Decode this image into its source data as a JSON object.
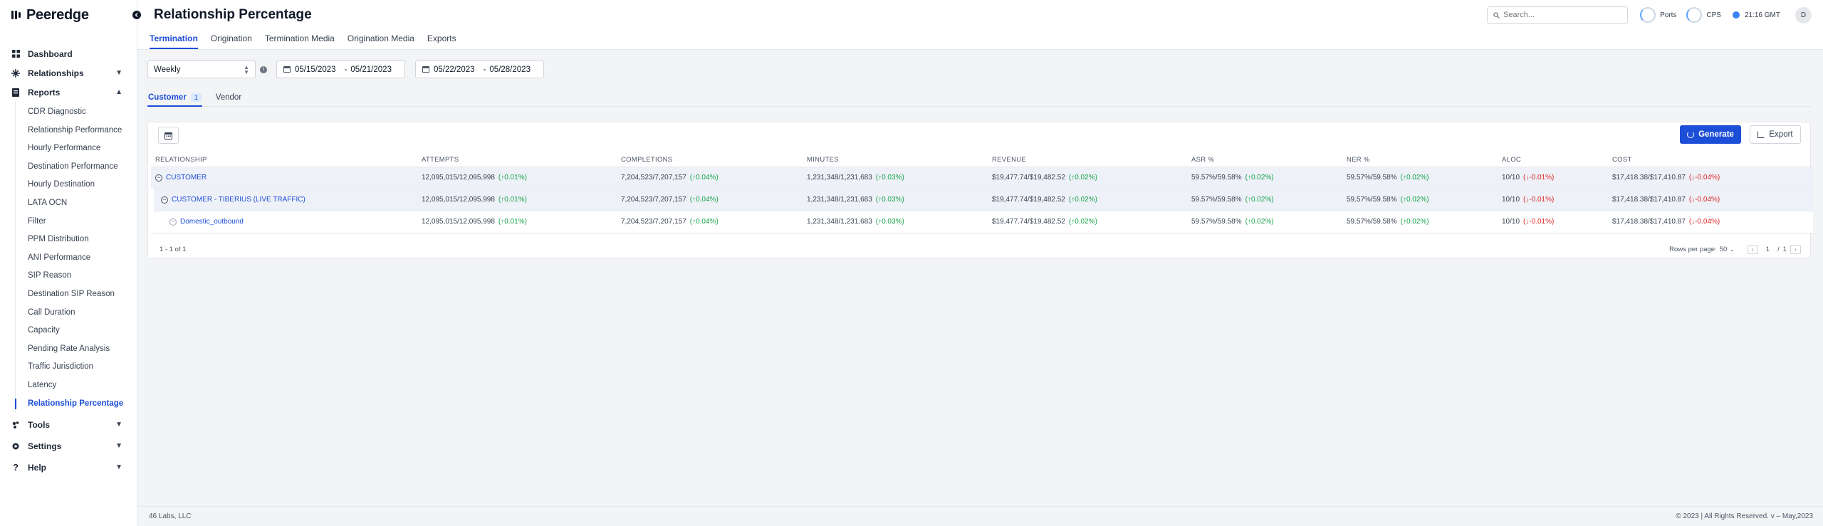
{
  "app": {
    "name": "Peeredge"
  },
  "header": {
    "title": "Relationship Percentage",
    "search_placeholder": "Search...",
    "ports_label": "Ports",
    "cps_label": "CPS",
    "time": "21:16 GMT",
    "avatar_initial": "D"
  },
  "sidebar": {
    "dashboard": "Dashboard",
    "relationships": "Relationships",
    "reports": "Reports",
    "report_items": [
      "CDR Diagnostic",
      "Relationship Performance",
      "Hourly Performance",
      "Destination Performance",
      "Hourly Destination",
      "LATA OCN",
      "Filter",
      "PPM Distribution",
      "ANI Performance",
      "SIP Reason",
      "Destination SIP Reason",
      "Call Duration",
      "Capacity",
      "Pending Rate Analysis",
      "Traffic Jurisdiction",
      "Latency",
      "Relationship Percentage"
    ],
    "tools": "Tools",
    "settings": "Settings",
    "help": "Help"
  },
  "tabs": [
    "Termination",
    "Origination",
    "Termination Media",
    "Origination Media",
    "Exports"
  ],
  "filters": {
    "period": "Weekly",
    "range1_start": "05/15/2023",
    "range1_end": "05/21/2023",
    "range2_start": "05/22/2023",
    "range2_end": "05/28/2023"
  },
  "subtabs": {
    "customer": "Customer",
    "customer_count": "1",
    "vendor": "Vendor"
  },
  "actions": {
    "generate": "Generate",
    "export": "Export"
  },
  "table": {
    "headers": [
      "RELATIONSHIP",
      "ATTEMPTS",
      "COMPLETIONS",
      "MINUTES",
      "REVENUE",
      "ASR %",
      "NER %",
      "ALOC",
      "COST"
    ],
    "rows": [
      {
        "name": "CUSTOMER",
        "toggle": "−",
        "attempts": "12,095,015/12,095,998",
        "attempts_delta": "(↑0.01%)",
        "completions": "7,204,523/7,207,157",
        "completions_delta": "(↑0.04%)",
        "minutes": "1,231,348/1,231,683",
        "minutes_delta": "(↑0.03%)",
        "revenue": "$19,477.74/$19,482.52",
        "revenue_delta": "(↑0.02%)",
        "asr": "59.57%/59.58%",
        "asr_delta": "(↑0.02%)",
        "ner": "59.57%/59.58%",
        "ner_delta": "(↑0.02%)",
        "aloc": "10/10",
        "aloc_delta": "(↓-0.01%)",
        "cost": "$17,418.38/$17,410.87",
        "cost_delta": "(↓-0.04%)"
      },
      {
        "name": "CUSTOMER - TIBERIUS (LIVE TRAFFIC)",
        "toggle": "−",
        "attempts": "12,095,015/12,095,998",
        "attempts_delta": "(↑0.01%)",
        "completions": "7,204,523/7,207,157",
        "completions_delta": "(↑0.04%)",
        "minutes": "1,231,348/1,231,683",
        "minutes_delta": "(↑0.03%)",
        "revenue": "$19,477.74/$19,482.52",
        "revenue_delta": "(↑0.02%)",
        "asr": "59.57%/59.58%",
        "asr_delta": "(↑0.02%)",
        "ner": "59.57%/59.58%",
        "ner_delta": "(↑0.02%)",
        "aloc": "10/10",
        "aloc_delta": "(↓-0.01%)",
        "cost": "$17,418.38/$17,410.87",
        "cost_delta": "(↓-0.04%)"
      },
      {
        "name": "Domestic_outbound",
        "toggle": "−",
        "attempts": "12,095,015/12,095,998",
        "attempts_delta": "(↑0.01%)",
        "completions": "7,204,523/7,207,157",
        "completions_delta": "(↑0.04%)",
        "minutes": "1,231,348/1,231,683",
        "minutes_delta": "(↑0.03%)",
        "revenue": "$19,477.74/$19,482.52",
        "revenue_delta": "(↑0.02%)",
        "asr": "59.57%/59.58%",
        "asr_delta": "(↑0.02%)",
        "ner": "59.57%/59.58%",
        "ner_delta": "(↑0.02%)",
        "aloc": "10/10",
        "aloc_delta": "(↓-0.01%)",
        "cost": "$17,418.38/$17,410.87",
        "cost_delta": "(↓-0.04%)"
      }
    ],
    "footer": {
      "range_text": "1 - 1 of 1",
      "rows_per_page_label": "Rows per page:",
      "rows_per_page_value": "50",
      "page_current": "1",
      "page_sep": "/",
      "page_total": "1"
    }
  },
  "footer": {
    "company": "46 Labs, LLC",
    "copyright": "© 2023 | All Rights Reserved. v – May,2023"
  },
  "colors": {
    "accent": "#1d4ed8",
    "positive": "#16a34a",
    "negative": "#dc2626"
  }
}
